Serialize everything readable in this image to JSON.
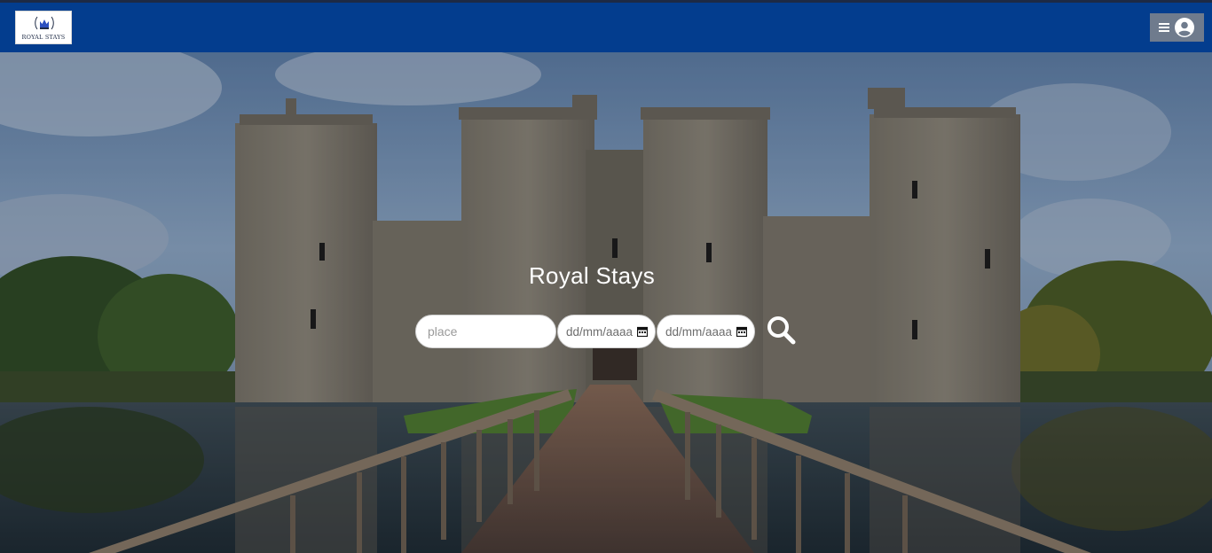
{
  "brand": {
    "logo_text": "ROYAL STAYS"
  },
  "hero": {
    "title": "Royal Stays"
  },
  "search": {
    "place_placeholder": "place",
    "checkin_placeholder": "dd/mm/aaaa",
    "checkout_placeholder": "dd/mm/aaaa"
  },
  "icons": {
    "menu": "hamburger-icon",
    "account": "user-circle-icon",
    "search": "magnifier-icon",
    "calendar": "calendar-icon",
    "logo": "crown-laurel-icon"
  },
  "colors": {
    "navbar": "#033d8e",
    "menu_button": "#6f7b8d",
    "title_text": "#ffffff"
  }
}
